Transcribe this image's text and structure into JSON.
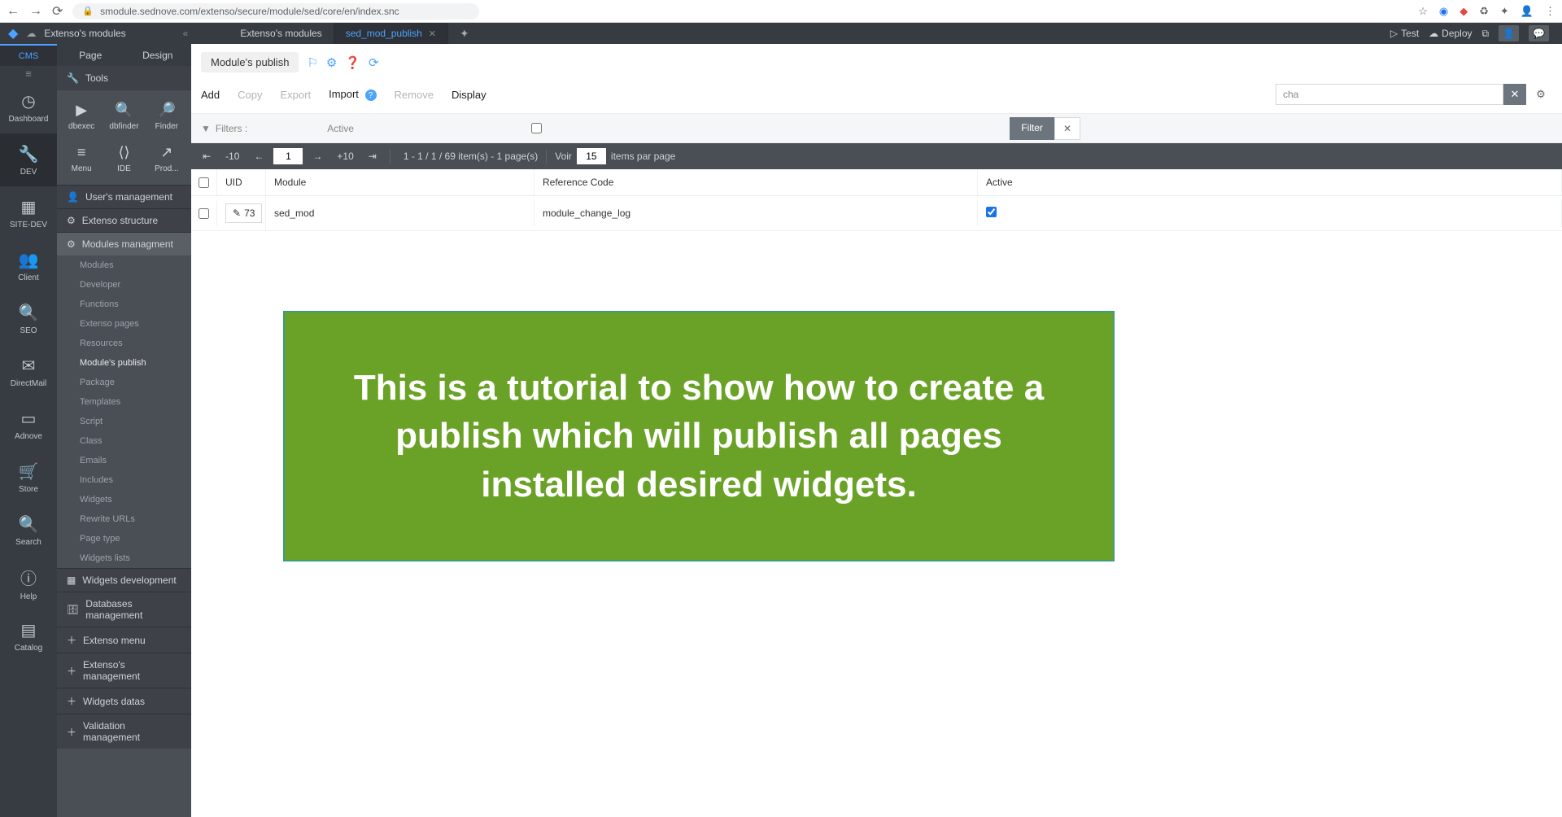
{
  "browser": {
    "url": "smodule.sednove.com/extenso/secure/module/sed/core/en/index.snc"
  },
  "appbar": {
    "title": "Extenso's modules",
    "tabs": [
      {
        "label": "Extenso's modules",
        "active": false
      },
      {
        "label": "sed_mod_publish",
        "active": true
      }
    ],
    "right": {
      "test": "Test",
      "deploy": "Deploy"
    }
  },
  "rail": {
    "cms": "CMS",
    "items": [
      {
        "icon": "gauge",
        "label": "Dashboard"
      },
      {
        "icon": "wrench",
        "label": "DEV"
      },
      {
        "icon": "cube",
        "label": "SITE-DEV"
      },
      {
        "icon": "users",
        "label": "Client"
      },
      {
        "icon": "search",
        "label": "SEO"
      },
      {
        "icon": "mail",
        "label": "DirectMail"
      },
      {
        "icon": "ad",
        "label": "Adnove"
      },
      {
        "icon": "cart",
        "label": "Store"
      },
      {
        "icon": "search2",
        "label": "Search"
      },
      {
        "icon": "info",
        "label": "Help"
      },
      {
        "icon": "catalog",
        "label": "Catalog"
      }
    ]
  },
  "sidebar": {
    "topTabs": {
      "page": "Page",
      "design": "Design"
    },
    "tools": "Tools",
    "toolGrid": [
      {
        "label": "dbexec"
      },
      {
        "label": "dbfinder"
      },
      {
        "label": "Finder"
      },
      {
        "label": "Menu"
      },
      {
        "label": "IDE"
      },
      {
        "label": "Prod..."
      }
    ],
    "sections": [
      {
        "icon": "user",
        "label": "User's management"
      },
      {
        "icon": "sitemap",
        "label": "Extenso structure"
      },
      {
        "icon": "cogs",
        "label": "Modules managment",
        "active": true
      }
    ],
    "subs": [
      "Modules",
      "Developer",
      "Functions",
      "Extenso pages",
      "Resources",
      "Module's publish",
      "Package",
      "Templates",
      "Script",
      "Class",
      "Emails",
      "Includes",
      "Widgets",
      "Rewrite URLs",
      "Page type",
      "Widgets lists"
    ],
    "bottom": [
      {
        "icon": "widgets",
        "label": "Widgets development"
      },
      {
        "icon": "db",
        "label": "Databases management"
      },
      {
        "icon": "plus",
        "label": "Extenso menu"
      },
      {
        "icon": "plus",
        "label": "Extenso's management"
      },
      {
        "icon": "plus",
        "label": "Widgets datas"
      },
      {
        "icon": "plus",
        "label": "Validation management"
      }
    ]
  },
  "content": {
    "title": "Module's publish",
    "actions": {
      "add": "Add",
      "copy": "Copy",
      "export": "Export",
      "import": "Import",
      "remove": "Remove",
      "display": "Display"
    },
    "search": {
      "value": "cha"
    },
    "filter": {
      "label": "Filters :",
      "active": "Active",
      "btn": "Filter"
    },
    "pager": {
      "m10": "-10",
      "p10": "+10",
      "page": "1",
      "info": "1 - 1 / 1 / 69 item(s) - 1 page(s)",
      "voir": "Voir",
      "per": "15",
      "per_label": "items par page"
    },
    "table": {
      "headers": {
        "uid": "UID",
        "module": "Module",
        "ref": "Reference Code",
        "active": "Active"
      },
      "rows": [
        {
          "uid": "73",
          "module": "sed_mod",
          "ref": "module_change_log",
          "active": true
        }
      ]
    }
  },
  "overlay": {
    "text": "This is a tutorial to show how to create a publish which will publish all pages installed desired widgets."
  }
}
